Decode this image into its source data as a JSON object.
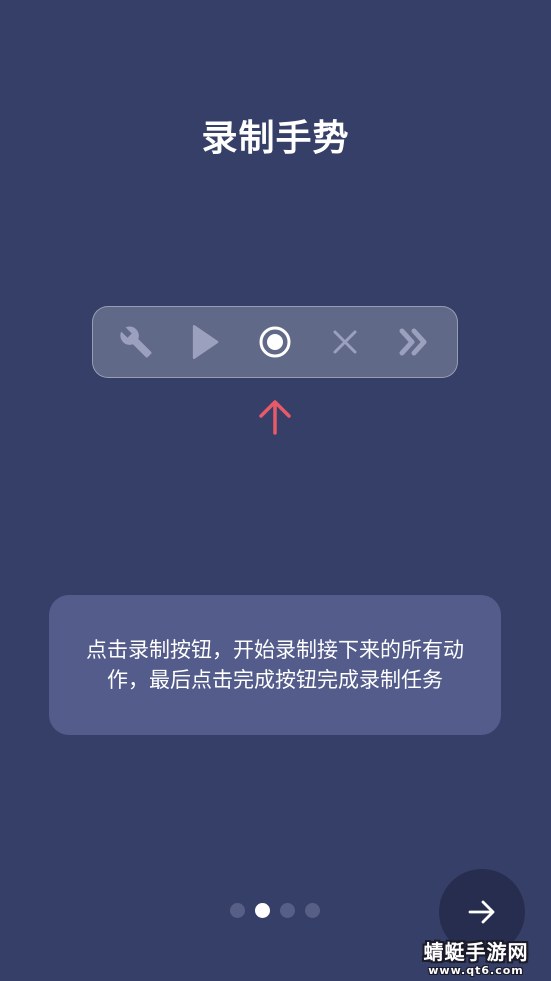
{
  "header": {
    "title": "录制手势"
  },
  "toolbar": {
    "buttons": [
      {
        "icon": "wrench-icon"
      },
      {
        "icon": "play-icon"
      },
      {
        "icon": "record-icon"
      },
      {
        "icon": "close-icon"
      },
      {
        "icon": "double-chevron-right-icon"
      }
    ]
  },
  "tip": {
    "text": "点击录制按钮，开始录制接下来的所有动作，最后点击完成按钮完成录制任务"
  },
  "pager": {
    "total": 4,
    "active_index": 1
  },
  "watermark": {
    "title": "蜻蜓手游网",
    "url": "www.qt6.com"
  },
  "colors": {
    "background": "#353f67",
    "card": "#535c8b",
    "arrow": "#e85a6a",
    "next_button": "#262d4e"
  }
}
